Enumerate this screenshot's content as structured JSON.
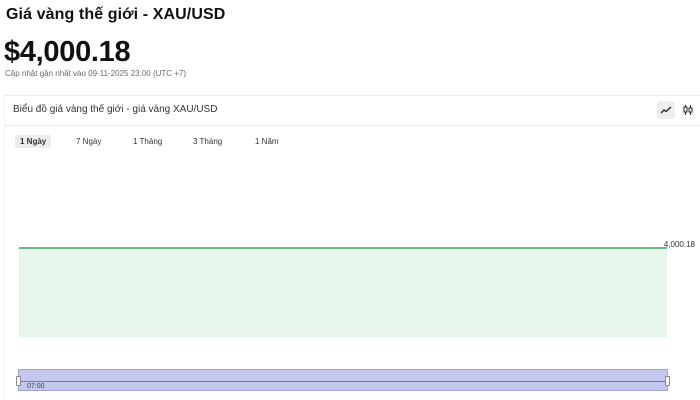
{
  "header": {
    "title": "Giá vàng thế giới - XAU/USD",
    "price": "$4,000.18",
    "updated": "Cập nhật gần nhất vào 09-11-2025 23:00 (UTC +7)"
  },
  "chart_card": {
    "title": "Biểu đồ giá vàng thế giới - giá vàng XAU/USD",
    "tools": [
      {
        "icon": "line-chart-icon",
        "active": true
      },
      {
        "icon": "candlestick-icon",
        "active": false
      }
    ],
    "tabs": [
      {
        "label": "1 Ngày",
        "active": true
      },
      {
        "label": "7 Ngày",
        "active": false
      },
      {
        "label": "1 Tháng",
        "active": false
      },
      {
        "label": "3 Tháng",
        "active": false
      },
      {
        "label": "1 Năm",
        "active": false
      }
    ],
    "navigator": {
      "time_label": "07:00"
    }
  },
  "colors": {
    "line": "#3aa35a",
    "area": "#e8f5ec",
    "navigator_fill": "#c5c8ee"
  },
  "chart_data": {
    "type": "area",
    "title": "",
    "series": [
      {
        "values": [
          4000.18,
          4000.18
        ]
      }
    ],
    "last_value_label": "4,000.18",
    "grid": false
  }
}
